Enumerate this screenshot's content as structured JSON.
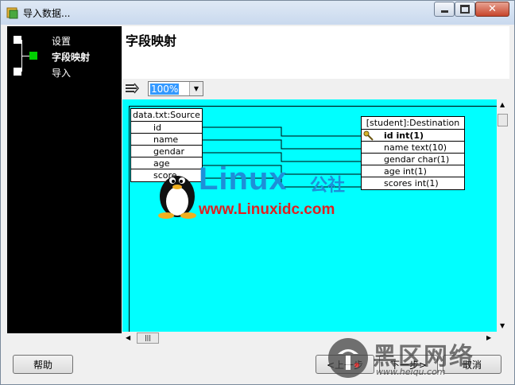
{
  "window": {
    "title": "导入数据..."
  },
  "sidebar": {
    "steps": [
      {
        "label": "设置"
      },
      {
        "label": "字段映射"
      },
      {
        "label": "导入"
      }
    ]
  },
  "header": {
    "title": "字段映射"
  },
  "toolbar": {
    "zoom": "100%"
  },
  "mapping": {
    "source": {
      "title": "data.txt:Source",
      "fields": [
        "id",
        "name",
        "gendar",
        "age",
        "score"
      ]
    },
    "destination": {
      "title": "[student]:Destination",
      "fields": [
        "id int(1)",
        "name text(10)",
        "gendar char(1)",
        "age int(1)",
        "scores int(1)"
      ]
    }
  },
  "watermark": {
    "brand": "Linux",
    "brand_cn": "公社",
    "url": "www.Linuxidc.com",
    "logo2_cn": "黑区网络",
    "logo2_url": "www.heiqu.com"
  },
  "footer": {
    "help": "帮助",
    "prev": "<上一步",
    "next": "下一步>",
    "cancel": "取消"
  },
  "colors": {
    "canvas": "#00ffff",
    "current_step": "#00d000",
    "sidebar": "#000000"
  }
}
